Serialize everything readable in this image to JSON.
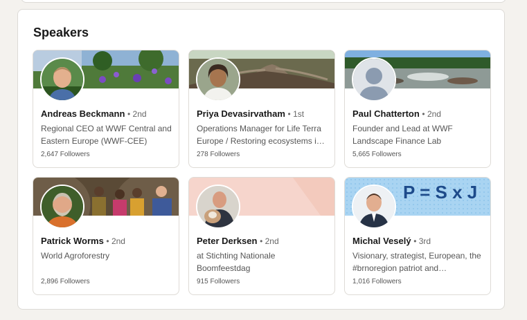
{
  "section": {
    "title": "Speakers"
  },
  "speakers": [
    {
      "name": "Andreas Beckmann",
      "degree": "• 2nd",
      "headline": "Regional CEO at WWF Central and Eastern Europe (WWF-CEE)",
      "followers": "2,647 Followers",
      "banner_icon": "flower-field-banner",
      "avatar_icon": "man-photo-avatar"
    },
    {
      "name": "Priya Devasirvatham",
      "degree": "• 1st",
      "headline": "Operations Manager for Life Terra Europe / Restoring ecosystems i…",
      "followers": "278 Followers",
      "banner_icon": "tree-roots-banner",
      "avatar_icon": "woman-photo-avatar"
    },
    {
      "name": "Paul Chatterton",
      "degree": "• 2nd",
      "headline": "Founder and Lead at WWF Landscape Finance Lab",
      "followers": "5,665 Followers",
      "banner_icon": "river-landscape-banner",
      "avatar_icon": "default-person-avatar"
    },
    {
      "name": "Patrick Worms",
      "degree": "• 2nd",
      "headline": "World Agroforestry",
      "followers": "2,896 Followers",
      "banner_icon": "group-photo-banner",
      "avatar_icon": "bearded-man-avatar"
    },
    {
      "name": "Peter Derksen",
      "degree": "• 2nd",
      "headline": "at Stichting Nationale Boomfeestdag",
      "followers": "915 Followers",
      "banner_icon": "peach-banner",
      "avatar_icon": "man-with-dog-avatar"
    },
    {
      "name": "Michal Veselý",
      "degree": "• 3rd",
      "headline": "Visionary, strategist, European, the #brnoregion patriot and…",
      "followers": "1,016 Followers",
      "banner_icon": "equation-banner",
      "banner_text": "P = S x J",
      "avatar_icon": "man-suit-avatar"
    }
  ],
  "colors": {
    "brand_blue": "#0a66c2",
    "text_dark": "#191919",
    "text_muted": "#666666",
    "banner_peach": "#f6d5cc",
    "banner_sky": "#a9d4f2"
  }
}
